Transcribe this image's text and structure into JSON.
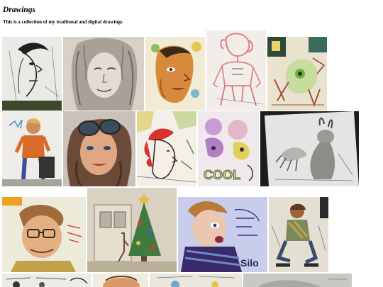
{
  "header": {
    "title": "Drawings",
    "subtitle": "This is a collection of my traditonal and digital drawings"
  },
  "colors": {
    "paper": "#eae6df",
    "pencil": "#2a2a2a",
    "skin": "#e8a66a",
    "accent_red": "#d23a34",
    "accent_blue": "#3d5cc7",
    "accent_yellow": "#e2c24a",
    "accent_pink": "#e89aa3",
    "sketch_bg_dark": "#1c1c1c"
  },
  "gallery": {
    "items": [
      {
        "name": "man-profile-lines",
        "row": 1
      },
      {
        "name": "curly-hair-face",
        "row": 1
      },
      {
        "name": "orange-face-flowers",
        "row": 1
      },
      {
        "name": "pink-figure-sketch",
        "row": 1
      },
      {
        "name": "creature-doodle-collage",
        "row": 1
      },
      {
        "name": "boy-orange-sweater",
        "row": 2
      },
      {
        "name": "goggles-portrait",
        "row": 2
      },
      {
        "name": "red-hair-profile",
        "row": 2
      },
      {
        "name": "cool-purple-doodles",
        "row": 2
      },
      {
        "name": "rabbit-pencil-drawing",
        "row": 2
      },
      {
        "name": "glasses-man-portrait",
        "row": 3
      },
      {
        "name": "christmas-tree-house",
        "row": 3
      },
      {
        "name": "blue-spirit-portrait",
        "row": 3
      },
      {
        "name": "sitting-figure-sketch",
        "row": 3
      },
      {
        "name": "comic-sketch-partial",
        "row": 4
      },
      {
        "name": "skin-sketch-partial",
        "row": 4
      },
      {
        "name": "paper-sketch-partial",
        "row": 4
      },
      {
        "name": "grey-drawing-partial",
        "row": 4
      }
    ]
  }
}
